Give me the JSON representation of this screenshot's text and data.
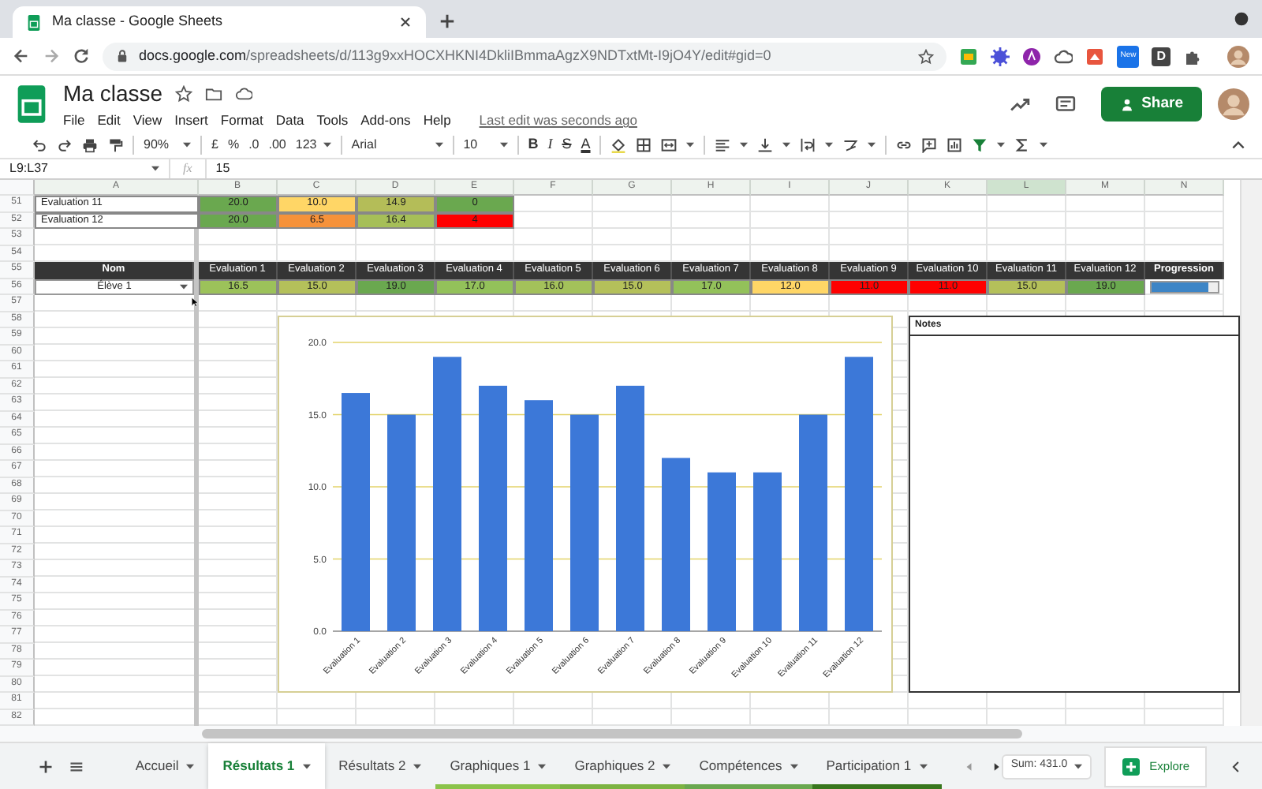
{
  "browser": {
    "tab_title": "Ma classe - Google Sheets",
    "url_host": "docs.google.com",
    "url_path": "/spreadsheets/d/113g9xxHOCXHKNI4DkliIBmmaAgzX9NDTxtMt-I9jO4Y/edit#gid=0",
    "extension_badge": "New",
    "extension_letter": "D"
  },
  "document": {
    "title": "Ma classe",
    "menu": [
      "File",
      "Edit",
      "View",
      "Insert",
      "Format",
      "Data",
      "Tools",
      "Add-ons",
      "Help"
    ],
    "last_edit": "Last edit was seconds ago",
    "share_button": "Share"
  },
  "toolbar": {
    "zoom": "90%",
    "currency": "£",
    "percent": "%",
    "decrease_decimals": ".0",
    "increase_decimals": ".00",
    "more_formats": "123",
    "font": "Arial",
    "font_size": "10",
    "bold": "B",
    "italic": "I",
    "strikethrough": "S",
    "text_color": "A"
  },
  "formula_bar": {
    "name_box": "L9:L37",
    "fx": "fx",
    "value": "15"
  },
  "columns": [
    {
      "label": "A",
      "selected": false
    },
    {
      "label": "B",
      "selected": false
    },
    {
      "label": "C",
      "selected": false
    },
    {
      "label": "D",
      "selected": false
    },
    {
      "label": "E",
      "selected": false
    },
    {
      "label": "F",
      "selected": false
    },
    {
      "label": "G",
      "selected": false
    },
    {
      "label": "H",
      "selected": false
    },
    {
      "label": "I",
      "selected": false
    },
    {
      "label": "J",
      "selected": false
    },
    {
      "label": "K",
      "selected": false
    },
    {
      "label": "L",
      "selected": true
    },
    {
      "label": "M",
      "selected": false
    },
    {
      "label": "N",
      "selected": false
    }
  ],
  "rows": [
    {
      "number": "51",
      "kind": "data",
      "label": "Evaluation 11",
      "cells": [
        {
          "text": "20.0",
          "color": "#6aa84f"
        },
        {
          "text": "10.0",
          "color": "#ffd666"
        },
        {
          "text": "14.9",
          "color": "#b4bd58"
        },
        {
          "text": "0",
          "color": "#6aa84f"
        }
      ]
    },
    {
      "number": "52",
      "kind": "data",
      "label": "Evaluation 12",
      "cells": [
        {
          "text": "20.0",
          "color": "#6aa84f"
        },
        {
          "text": "6.5",
          "color": "#f6923a"
        },
        {
          "text": "16.4",
          "color": "#a6bf58"
        },
        {
          "text": "4",
          "color": "#ff0000"
        }
      ]
    },
    {
      "number": "53"
    },
    {
      "number": "54"
    },
    {
      "number": "55",
      "kind": "header",
      "label": "Nom",
      "cells": [
        {
          "text": "Evaluation 1"
        },
        {
          "text": "Evaluation 2"
        },
        {
          "text": "Evaluation 3"
        },
        {
          "text": "Evaluation 4"
        },
        {
          "text": "Evaluation 5"
        },
        {
          "text": "Evaluation 6"
        },
        {
          "text": "Evaluation 7"
        },
        {
          "text": "Evaluation 8"
        },
        {
          "text": "Evaluation 9"
        },
        {
          "text": "Evaluation 10"
        },
        {
          "text": "Evaluation 11"
        },
        {
          "text": "Evaluation 12"
        },
        {
          "text": "Progression"
        }
      ]
    },
    {
      "number": "56",
      "kind": "student",
      "label": "Élève 1",
      "cells": [
        {
          "text": "16.5",
          "color": "#9cc25a"
        },
        {
          "text": "15.0",
          "color": "#b4c05a"
        },
        {
          "text": "19.0",
          "color": "#6aa84f"
        },
        {
          "text": "17.0",
          "color": "#93c15a"
        },
        {
          "text": "16.0",
          "color": "#a3c15a"
        },
        {
          "text": "15.0",
          "color": "#b4c05a"
        },
        {
          "text": "17.0",
          "color": "#93c15a"
        },
        {
          "text": "12.0",
          "color": "#ffd666"
        },
        {
          "text": "11.0",
          "color": "#ff0000"
        },
        {
          "text": "11.0",
          "color": "#ff0000"
        },
        {
          "text": "15.0",
          "color": "#b4c05a"
        },
        {
          "text": "19.0",
          "color": "#6aa84f"
        }
      ],
      "progress": {
        "level": 0.85
      }
    },
    {
      "number": "57"
    },
    {
      "number": "58"
    },
    {
      "number": "59"
    },
    {
      "number": "60"
    },
    {
      "number": "61"
    },
    {
      "number": "62"
    },
    {
      "number": "63"
    },
    {
      "number": "64"
    },
    {
      "number": "65"
    },
    {
      "number": "66"
    },
    {
      "number": "67"
    },
    {
      "number": "68"
    },
    {
      "number": "69"
    },
    {
      "number": "70"
    },
    {
      "number": "71"
    },
    {
      "number": "72"
    },
    {
      "number": "73"
    },
    {
      "number": "74"
    },
    {
      "number": "75"
    },
    {
      "number": "76"
    },
    {
      "number": "77"
    },
    {
      "number": "78"
    },
    {
      "number": "79"
    },
    {
      "number": "80"
    },
    {
      "number": "81"
    },
    {
      "number": "82"
    }
  ],
  "chart": {
    "chart_data": {
      "type": "bar",
      "categories": [
        "Evaluation 1",
        "Evaluation 2",
        "Evaluation 3",
        "Evaluation 4",
        "Evaluation 5",
        "Evaluation 6",
        "Evaluation 7",
        "Evaluation 8",
        "Evaluation 9",
        "Evaluation 10",
        "Evaluation 11",
        "Evaluation 12"
      ],
      "series": [
        {
          "color": "#3c78d8",
          "values": [
            16.5,
            15,
            19,
            17,
            16,
            15,
            17,
            12,
            11,
            11,
            15,
            19
          ]
        }
      ],
      "grid": true,
      "ylim": [
        0,
        20
      ],
      "yticks": [
        {
          "value": 0,
          "label": "0.0"
        },
        {
          "value": 5,
          "label": "5.0"
        },
        {
          "value": 10,
          "label": "10.0"
        },
        {
          "value": 15,
          "label": "15.0"
        },
        {
          "value": 20,
          "label": "20.0"
        }
      ]
    }
  },
  "notes": {
    "title": "Notes"
  },
  "sheet_tabs": [
    {
      "label": "Accueil",
      "selected": false
    },
    {
      "label": "Résultats 1",
      "selected": true
    },
    {
      "label": "Résultats 2",
      "selected": false
    },
    {
      "label": "Graphiques 1",
      "selected": false,
      "color": "#8bc34a"
    },
    {
      "label": "Graphiques 2",
      "selected": false,
      "color": "#7cb342"
    },
    {
      "label": "Compétences",
      "selected": false,
      "color": "#6aa84f"
    },
    {
      "label": "Participation 1",
      "selected": false,
      "color": "#38761d"
    }
  ],
  "status": {
    "sum": "Sum: 431.0",
    "explore": "Explore"
  }
}
